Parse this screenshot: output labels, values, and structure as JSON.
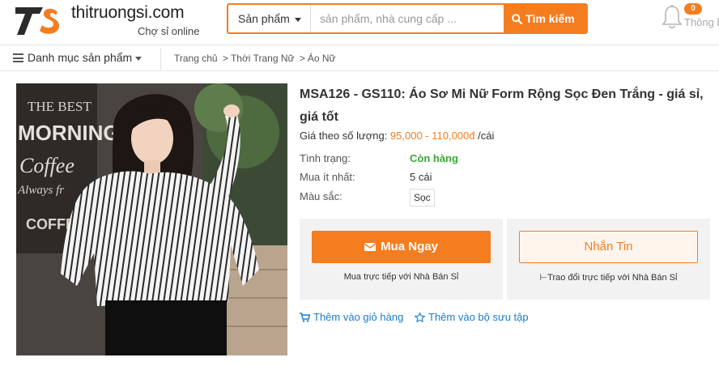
{
  "header": {
    "logo_text": "thitruongsi.com",
    "logo_sub": "Chợ sỉ online",
    "search_category": "Sản phẩm",
    "search_placeholder": "sản phẩm, nhà cung cấp ...",
    "search_button": "Tìm kiếm",
    "notif_count": "0",
    "notif_label": "Thông báo",
    "accent_color": "#f47d20"
  },
  "subnav": {
    "menu_label": "Danh mục sản phẩm",
    "breadcrumb": [
      "Trang chủ",
      "Thời Trang Nữ",
      "Áo Nữ"
    ]
  },
  "product": {
    "title": "MSA126 - GS110: Áo Sơ Mi Nữ Form Rộng Sọc Đen Trắng - giá sỉ, giá tốt",
    "price_label": "Giá theo số lượng:",
    "price_range": "95,000 - 110,000đ",
    "price_unit": "/cái",
    "status_label": "Tình trạng:",
    "status_value": "Còn hàng",
    "min_label": "Mua ít nhất:",
    "min_value": "5 cái",
    "color_label": "Màu sắc:",
    "color_value": "Sọc",
    "image_text": {
      "sign1": "THE BEST",
      "sign2": "MORNING",
      "sign3": "Coffee",
      "sign4": "Always fr",
      "sign5": "COFFEE"
    }
  },
  "actions": {
    "buy_label": "Mua Ngay",
    "buy_note": "Mua trực tiếp với Nhà Bán Sỉ",
    "msg_label": "Nhắn Tin",
    "msg_note": "Trao đổi trực tiếp với Nhà Bán Sỉ",
    "add_cart": "Thêm vào giỏ hàng",
    "add_collection": "Thêm vào bộ sưu tập"
  }
}
